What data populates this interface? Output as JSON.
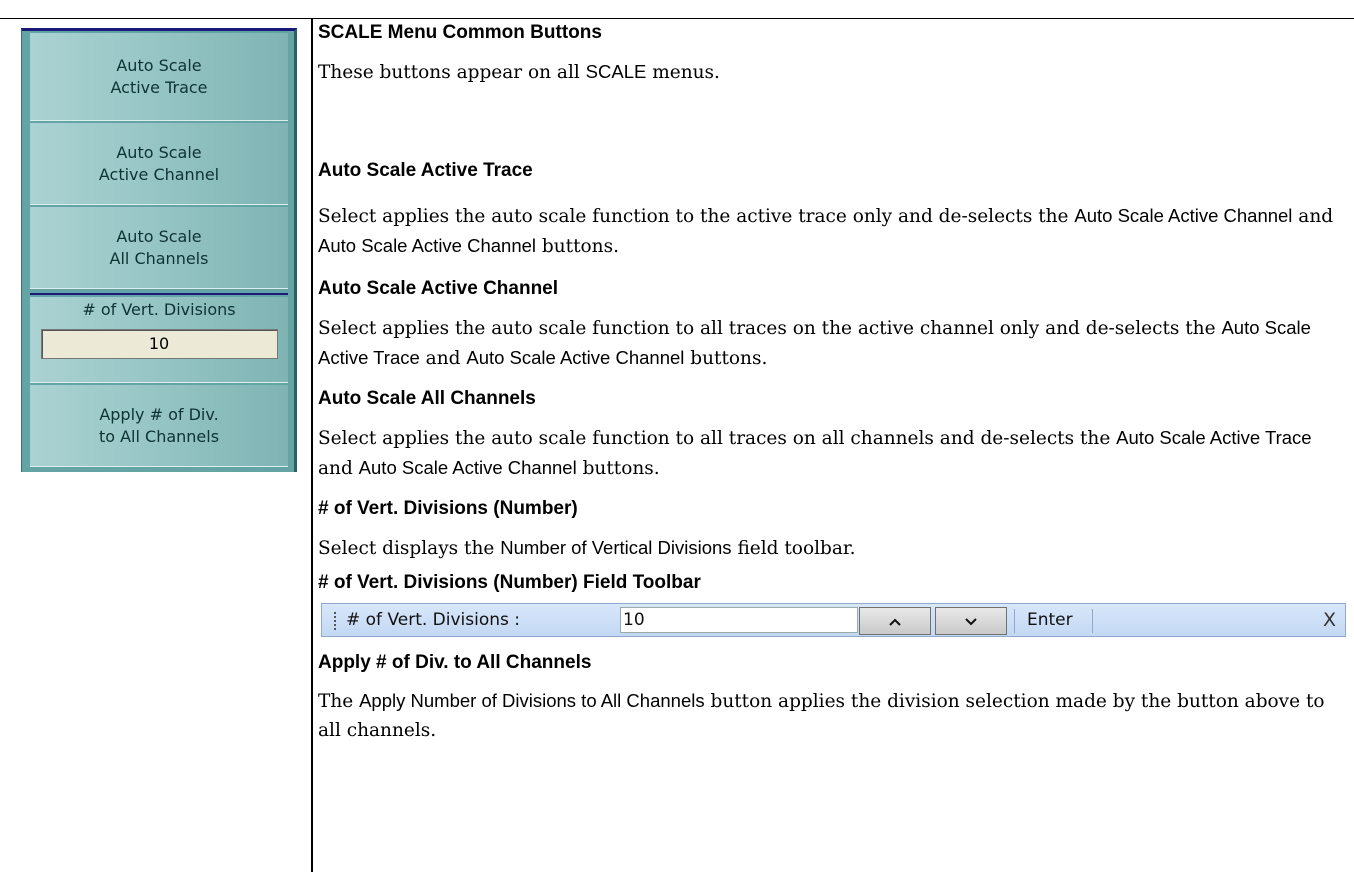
{
  "menu": {
    "buttons": [
      {
        "line1": "Auto Scale",
        "line2": "Active Trace"
      },
      {
        "line1": "Auto Scale",
        "line2": "Active Channel"
      },
      {
        "line1": "Auto Scale",
        "line2": "All Channels"
      }
    ],
    "vert_divisions": {
      "label": "# of Vert. Divisions",
      "value": "10"
    },
    "apply_button": {
      "line1": "Apply # of Div.",
      "line2": "to All Channels"
    }
  },
  "doc": {
    "s0": {
      "heading": "SCALE Menu Common Buttons",
      "p_a": "These buttons appear on all ",
      "p_b": "SCALE",
      "p_c": " menus."
    },
    "s1": {
      "heading": "Auto Scale Active Trace",
      "p_a": "Select applies the auto scale function to the active trace only and de-selects the ",
      "p_b": "Auto Scale Active Channel",
      "p_c": " and ",
      "p_d": "Auto Scale Active Channel",
      "p_e": " buttons."
    },
    "s2": {
      "heading": "Auto Scale Active Channel",
      "p_a": "Select applies the auto scale function to all traces on the active channel only and de-selects the ",
      "p_b": "Auto Scale Active Trace",
      "p_c": " and ",
      "p_d": "Auto Scale Active Channel",
      "p_e": " buttons."
    },
    "s3": {
      "heading": "Auto Scale All Channels",
      "p_a": "Select applies the auto scale function to all traces on all channels and de-selects the ",
      "p_b": "Auto Scale Active Trace",
      "p_c": " and ",
      "p_d": "Auto Scale Active Channel",
      "p_e": " buttons."
    },
    "s4": {
      "heading": "# of Vert. Divisions (Number)",
      "p_a": "Select displays the ",
      "p_b": "Number of Vertical Divisions",
      "p_c": " field toolbar."
    },
    "s5": {
      "heading": "# of Vert. Divisions (Number) Field Toolbar"
    },
    "s6": {
      "heading": "Apply # of Div. to All Channels",
      "p_a": "The ",
      "p_b": "Apply Number of Divisions to All Channels",
      "p_c": " button applies the division selection made by the button above to all channels."
    }
  },
  "toolbar": {
    "label": "# of Vert. Divisions :",
    "value": "10",
    "up_glyph": "^",
    "down_glyph": "v",
    "enter_label": "Enter",
    "close_label": "X"
  }
}
